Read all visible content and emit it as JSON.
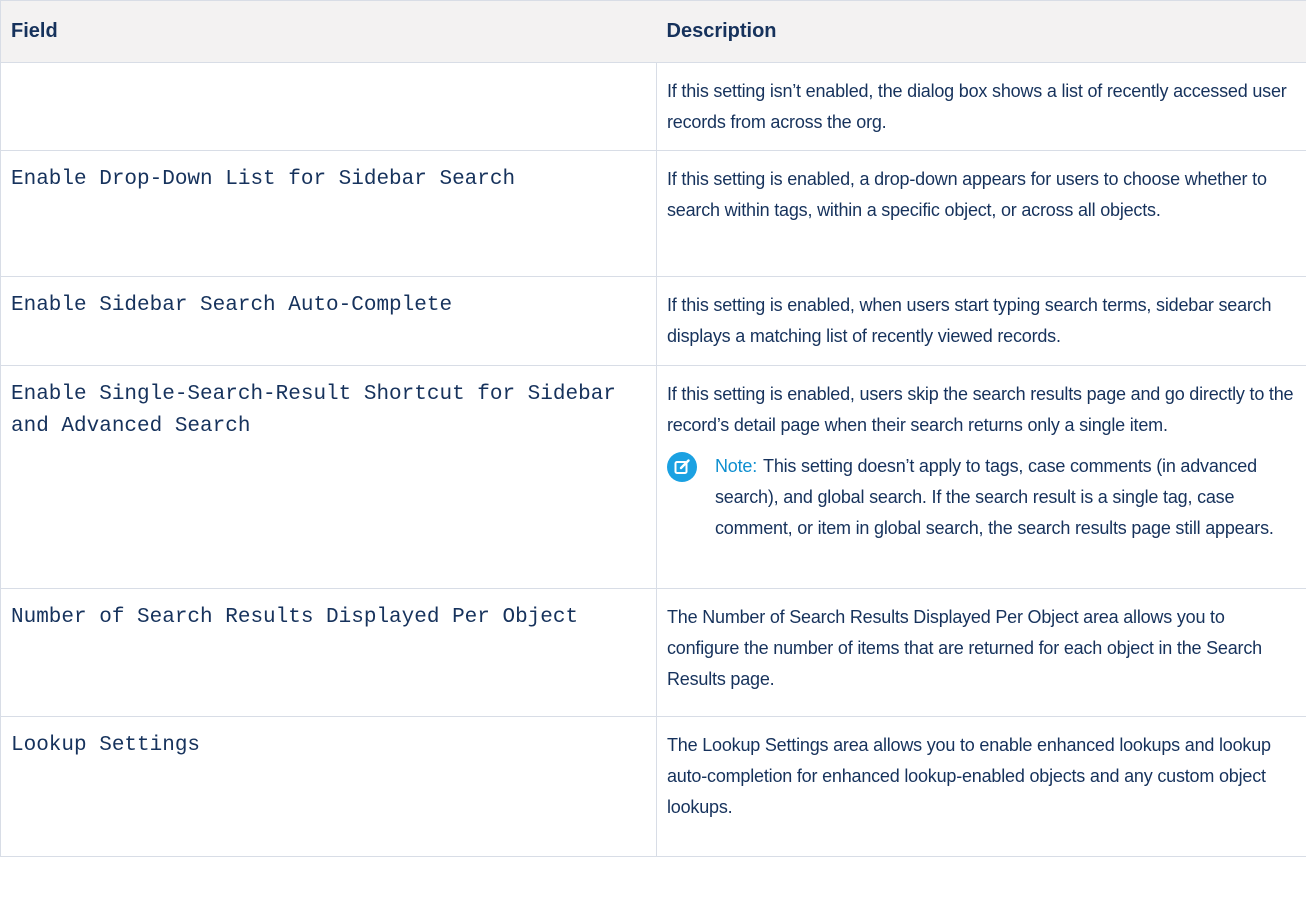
{
  "table": {
    "headers": {
      "field": "Field",
      "description": "Description"
    },
    "rows": [
      {
        "field": "",
        "description": "If this setting isn’t enabled, the dialog box shows a list of recently accessed user records from across the org."
      },
      {
        "field": "Enable Drop-Down List for Sidebar Search",
        "description": "If this setting is enabled, a drop-down appears for users to choose whether to search within tags, within a specific object, or across all objects."
      },
      {
        "field": "Enable Sidebar Search Auto-Complete",
        "description": "If this setting is enabled, when users start typing search terms, sidebar search displays a matching list of recently viewed records."
      },
      {
        "field": "Enable Single-Search-Result Shortcut for Sidebar and Advanced Search",
        "description": "If this setting is enabled, users skip the search results page and go directly to the record’s detail page when their search returns only a single item.",
        "note": {
          "label": "Note:",
          "text": "This setting doesn’t apply to tags, case comments (in advanced search), and global search. If the search result is a single tag, case comment, or item in global search, the search results page still appears.",
          "icon": "note-edit-icon",
          "color": "#1ba1e2"
        }
      },
      {
        "field": "Number of Search Results Displayed Per Object",
        "description": "The Number of Search Results Displayed Per Object area allows you to configure the number of items that are returned for each object in the Search Results page."
      },
      {
        "field": "Lookup Settings",
        "description": "The Lookup Settings area allows you to enable enhanced lookups and lookup auto-completion for enhanced lookup-enabled objects and any custom object lookups."
      }
    ]
  },
  "colors": {
    "text": "#16325c",
    "header_bg": "#f3f2f2",
    "border": "#d8dde6",
    "note_accent": "#0e8fd0"
  }
}
